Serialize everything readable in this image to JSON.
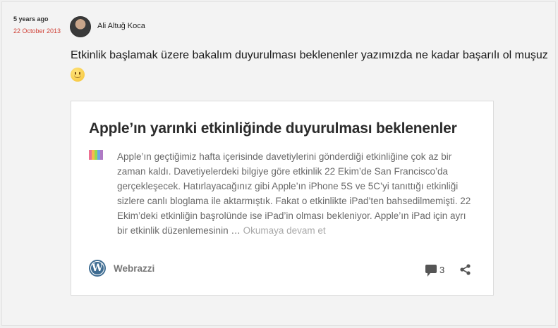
{
  "post": {
    "relative_time": "5 years ago",
    "date": "22 October 2013",
    "author": "Ali Altuğ Koca",
    "message": "Etkinlik başlamak üzere bakalım duyurulması beklenenler yazımızda ne kadar başarılı ol muşuz"
  },
  "embed": {
    "title": "Apple’ın yarınki etkinliğinde duyurulması beklenenler",
    "excerpt": "Apple’ın geçtiğimiz hafta içerisinde davetiylerini gönderdiği etkinliğine çok az bir zaman kaldı. Davetiyelerdeki bilgiye göre etkinlik 22 Ekim’de San Francisco’da gerçekleşecek. Hatırlayacağınız gibi Apple’ın iPhone 5S ve 5C’yi tanıttığı etkinliği sizlere canlı bloglama ile aktarmıştık. Fakat o etkinlikte iPad’ten bahsedilmemişti. 22 Ekim’deki etkinliğin başrolünde ise iPad’in olması bekleniyor. Apple’ın iPad için ayrı bir etkinlik düzenlemesinin …",
    "read_more": "Okumaya devam et",
    "site_name": "Webrazzi",
    "comment_count": "3"
  },
  "icons": {
    "site_logo": "wordpress-icon",
    "comments": "comment-icon",
    "share": "share-icon",
    "emoji": "smiley-icon"
  }
}
